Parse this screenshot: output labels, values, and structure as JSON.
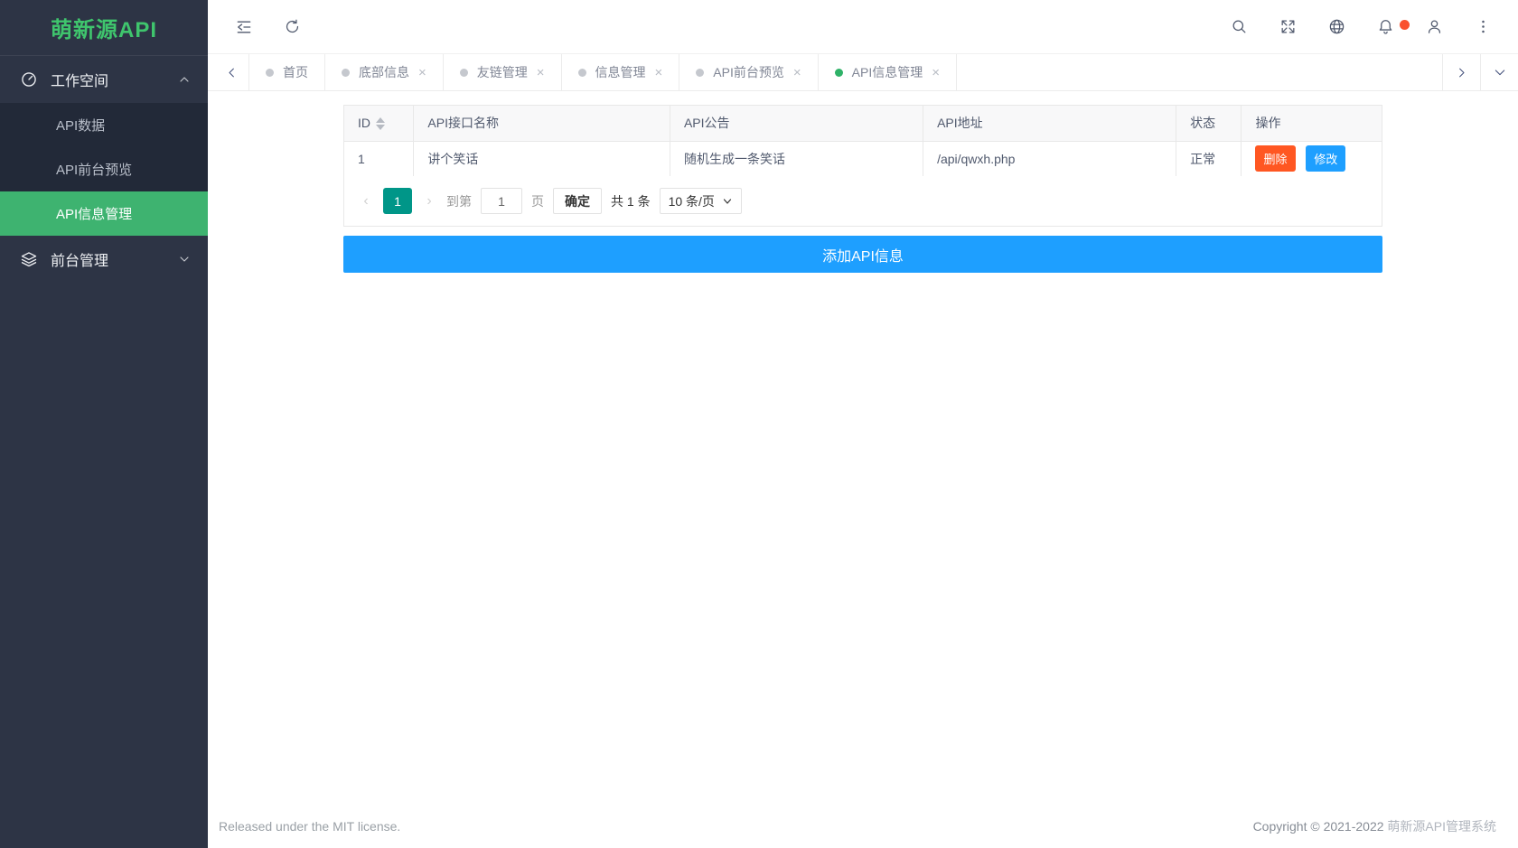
{
  "app": {
    "logo": "萌新源API"
  },
  "colors": {
    "sidebar_bg": "#2d3445",
    "submenu_bg": "#222938",
    "active_green": "#3eb370",
    "logo_green": "#3fc56d",
    "pager_green": "#009688",
    "primary_blue": "#1e9fff",
    "danger_orange": "#ff5722",
    "notify_dot": "#fa512e"
  },
  "sidebar": {
    "workspace": {
      "label": "工作空间",
      "icon": "gauge-icon",
      "state": "expanded"
    },
    "items": [
      {
        "label": "API数据",
        "active": false
      },
      {
        "label": "API前台预览",
        "active": false
      },
      {
        "label": "API信息管理",
        "active": true
      }
    ],
    "frontend": {
      "label": "前台管理",
      "icon": "layers-icon",
      "state": "collapsed"
    }
  },
  "topbar": {
    "icons": [
      "collapse-sidebar-icon",
      "refresh-icon",
      "search-icon",
      "fullscreen-icon",
      "globe-icon",
      "bell-icon",
      "user-icon",
      "more-vertical-icon"
    ],
    "notification_dot": true
  },
  "tabbar": {
    "close_glyph": "×",
    "tabs": [
      {
        "label": "首页",
        "closable": false,
        "active": false
      },
      {
        "label": "底部信息",
        "closable": true,
        "active": false
      },
      {
        "label": "友链管理",
        "closable": true,
        "active": false
      },
      {
        "label": "信息管理",
        "closable": true,
        "active": false
      },
      {
        "label": "API前台预览",
        "closable": true,
        "active": false
      },
      {
        "label": "API信息管理",
        "closable": true,
        "active": true
      }
    ]
  },
  "table": {
    "columns": [
      "ID",
      "API接口名称",
      "API公告",
      "API地址",
      "状态",
      "操作"
    ],
    "rows": [
      {
        "id": "1",
        "name": "讲个笑话",
        "notice": "随机生成一条笑话",
        "url": "/api/qwxh.php",
        "status": "正常",
        "delete_label": "删除",
        "edit_label": "修改"
      }
    ]
  },
  "pagination": {
    "prev_glyph": "‹",
    "next_glyph": "›",
    "current_page": "1",
    "goto_label": "到第",
    "goto_value": "1",
    "page_unit": "页",
    "confirm_label": "确定",
    "total_label": "共 1 条",
    "page_size": "10 条/页"
  },
  "actions": {
    "add_button_label": "添加API信息"
  },
  "footer": {
    "left": "Released under the MIT license.",
    "right_prefix": "Copyright © 2021-2022 ",
    "right_brand": "萌新源API管理系统"
  }
}
